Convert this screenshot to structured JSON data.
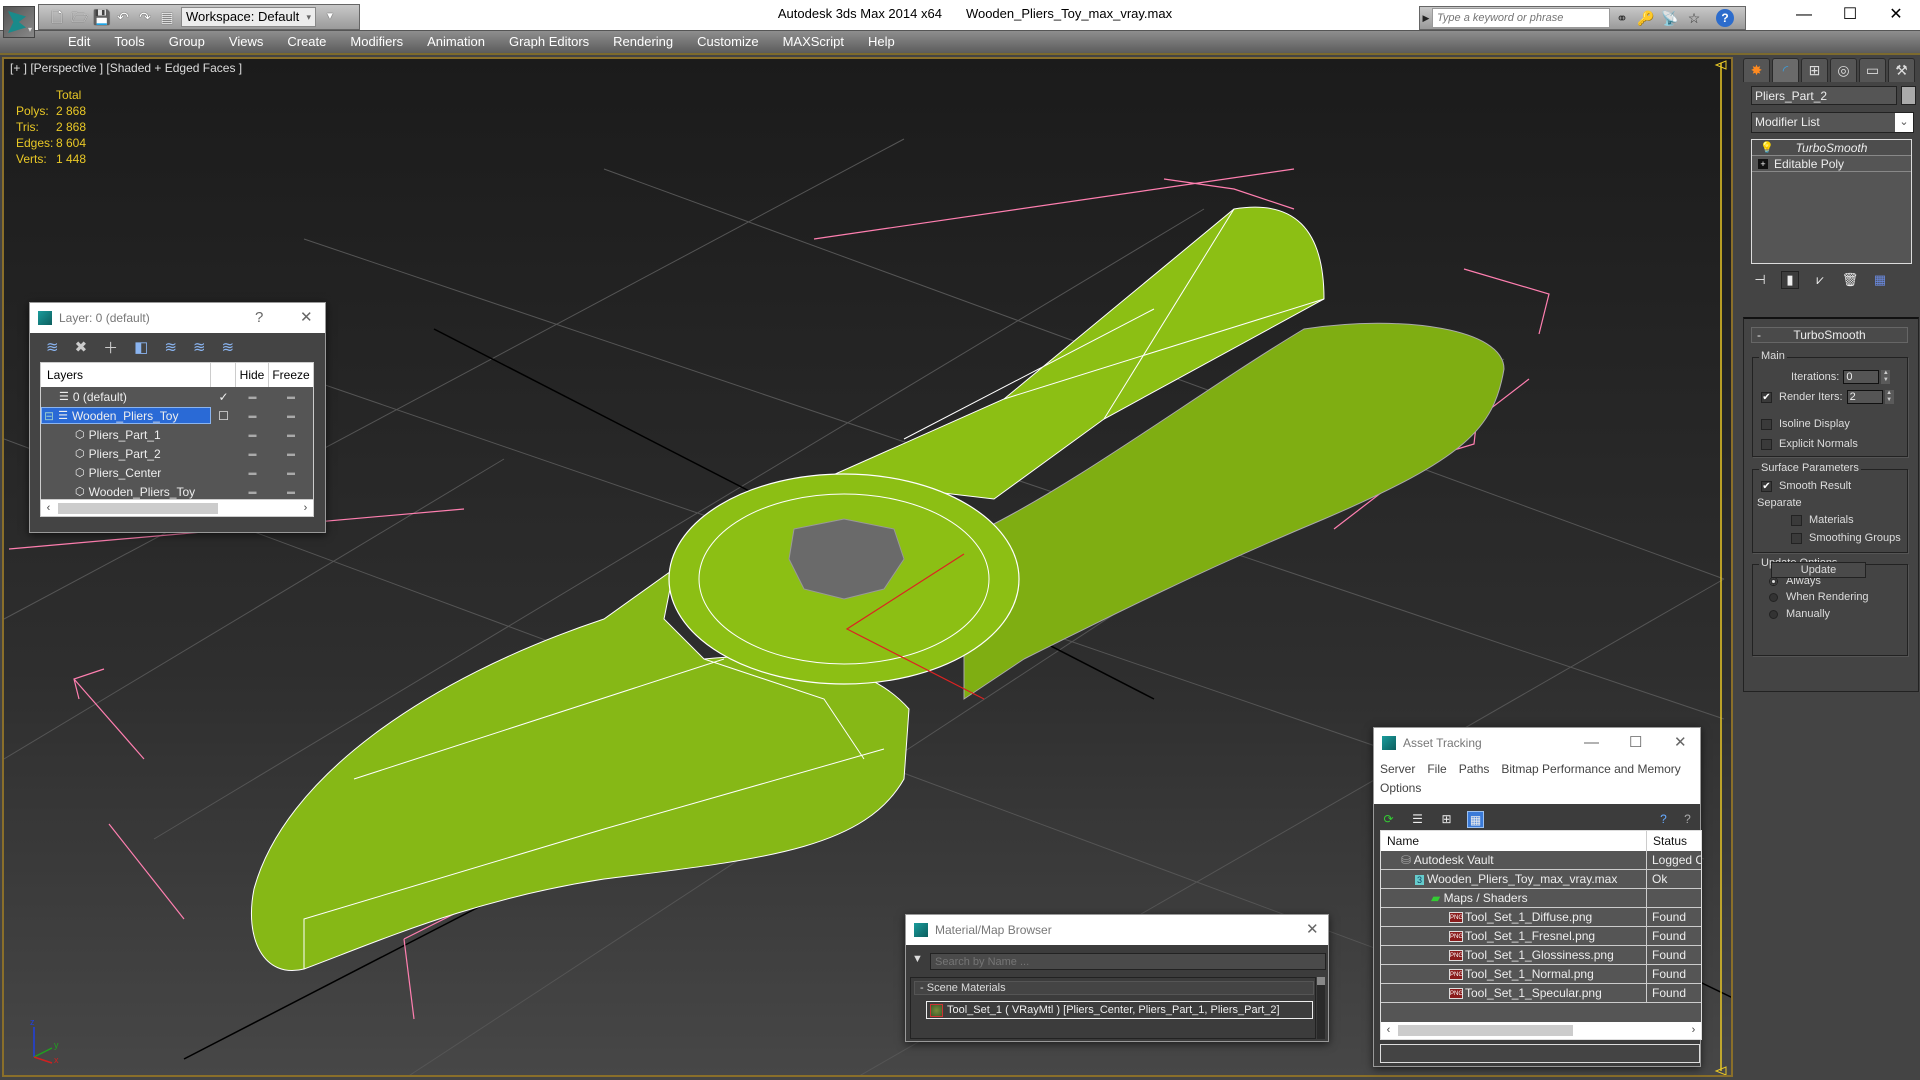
{
  "app": {
    "title": "Autodesk 3ds Max  2014 x64",
    "file": "Wooden_Pliers_Toy_max_vray.max",
    "workspace": "Workspace: Default",
    "search_placeholder": "Type a keyword or phrase"
  },
  "menu": [
    "Edit",
    "Tools",
    "Group",
    "Views",
    "Create",
    "Modifiers",
    "Animation",
    "Graph Editors",
    "Rendering",
    "Customize",
    "MAXScript",
    "Help"
  ],
  "viewport": {
    "label": "[+ ] [Perspective ] [Shaded + Edged Faces ]",
    "stats": {
      "header": "Total",
      "rows": [
        {
          "k": "Polys:",
          "v": "2 868"
        },
        {
          "k": "Tris:",
          "v": "2 868"
        },
        {
          "k": "Edges:",
          "v": "8 604"
        },
        {
          "k": "Verts:",
          "v": "1 448"
        }
      ]
    },
    "axis": {
      "x": "x",
      "y": "y",
      "z": "z"
    }
  },
  "layer_dialog": {
    "title": "Layer: 0 (default)",
    "help": "?",
    "columns": [
      "Layers",
      "",
      "Hide",
      "Freeze"
    ],
    "rows": [
      {
        "name": "0 (default)",
        "indent": 1,
        "check": "✓",
        "icon": "layer-stack"
      },
      {
        "name": "Wooden_Pliers_Toy",
        "indent": 0,
        "check": "☐",
        "icon": "layer-stack",
        "selected": true,
        "expander": "⊟"
      },
      {
        "name": "Pliers_Part_1",
        "indent": 2,
        "check": "",
        "icon": "object"
      },
      {
        "name": "Pliers_Part_2",
        "indent": 2,
        "check": "",
        "icon": "object"
      },
      {
        "name": "Pliers_Center",
        "indent": 2,
        "check": "",
        "icon": "object"
      },
      {
        "name": "Wooden_Pliers_Toy",
        "indent": 2,
        "check": "",
        "icon": "object"
      }
    ]
  },
  "command_panel": {
    "object_name": "Pliers_Part_2",
    "modifier_list": "Modifier List",
    "stack": [
      "TurboSmooth",
      "Editable Poly"
    ],
    "rollout": {
      "title": "TurboSmooth",
      "main_group": "Main",
      "iterations_label": "Iterations:",
      "iterations": "0",
      "render_iters_label": "Render Iters:",
      "render_iters": "2",
      "render_iters_checked": true,
      "isoline_display": "Isoline Display",
      "explicit_normals": "Explicit Normals",
      "surface_group": "Surface Parameters",
      "smooth_result": "Smooth Result",
      "separate": "Separate",
      "materials": "Materials",
      "smoothing_groups": "Smoothing Groups",
      "update_group": "Update Options",
      "update_always": "Always",
      "update_rendering": "When Rendering",
      "update_manually": "Manually",
      "update_button": "Update"
    }
  },
  "material_browser": {
    "title": "Material/Map Browser",
    "search_placeholder": "Search by Name ...",
    "group": "Scene Materials",
    "item": "Tool_Set_1  ( VRayMtl )  [Pliers_Center, Pliers_Part_1, Pliers_Part_2]"
  },
  "asset_tracking": {
    "title": "Asset Tracking",
    "menu": [
      "Server",
      "File",
      "Paths",
      "Bitmap Performance and Memory",
      "Options"
    ],
    "columns": [
      "Name",
      "Status"
    ],
    "rows": [
      {
        "name": "Autodesk Vault",
        "status": "Logged C",
        "indent": 1,
        "icon": "vault"
      },
      {
        "name": "Wooden_Pliers_Toy_max_vray.max",
        "status": "Ok",
        "indent": 2,
        "icon": "max-file"
      },
      {
        "name": "Maps / Shaders",
        "status": "",
        "indent": 3,
        "icon": "maps"
      },
      {
        "name": "Tool_Set_1_Diffuse.png",
        "status": "Found",
        "indent": 4,
        "icon": "png"
      },
      {
        "name": "Tool_Set_1_Fresnel.png",
        "status": "Found",
        "indent": 4,
        "icon": "png"
      },
      {
        "name": "Tool_Set_1_Glossiness.png",
        "status": "Found",
        "indent": 4,
        "icon": "png"
      },
      {
        "name": "Tool_Set_1_Normal.png",
        "status": "Found",
        "indent": 4,
        "icon": "png"
      },
      {
        "name": "Tool_Set_1_Specular.png",
        "status": "Found",
        "indent": 4,
        "icon": "png"
      }
    ]
  },
  "colors": {
    "stats_yellow": "#e9c826",
    "viewport_border": "#8a6f2a",
    "selection_blue": "#2a6ad6",
    "model_green": "#8cbf14",
    "bbox_pink": "#ff7fb0"
  }
}
